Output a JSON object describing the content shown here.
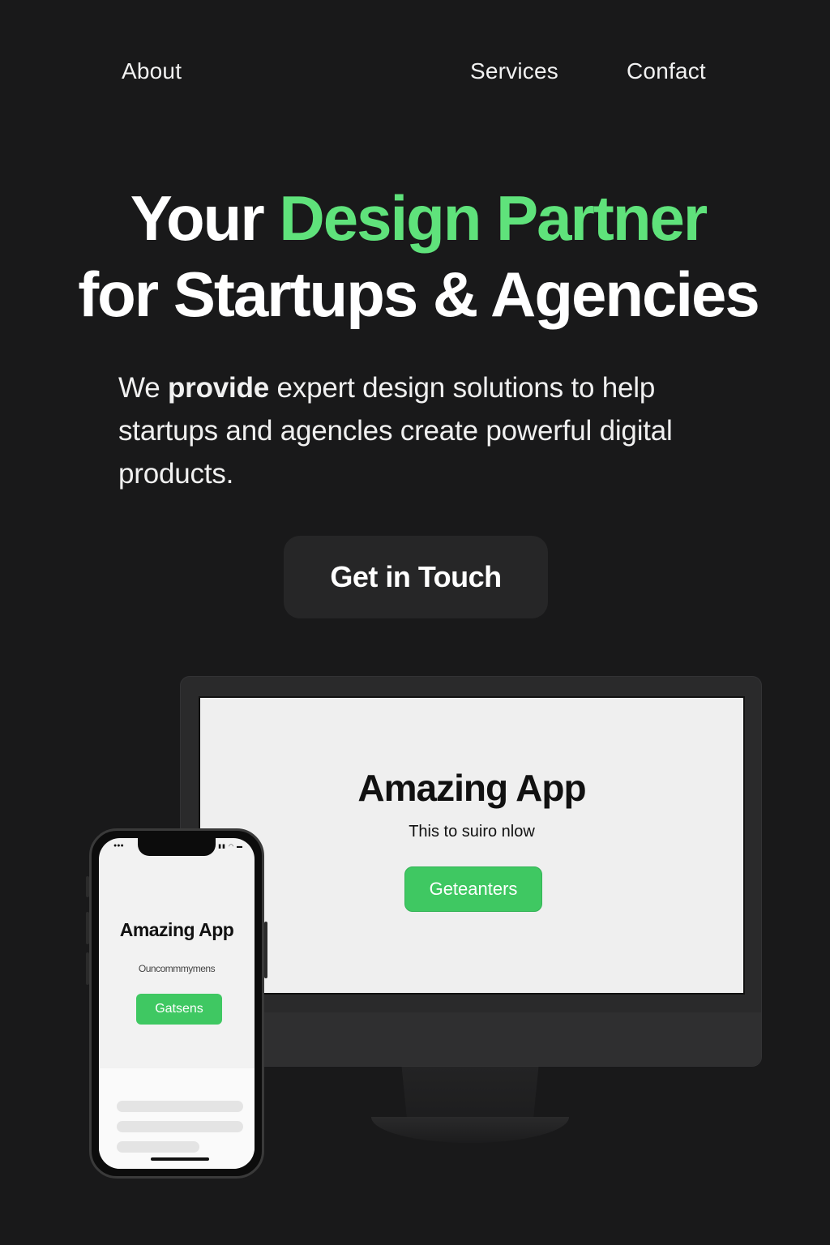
{
  "nav": {
    "about": "About",
    "services": "Services",
    "contact": "Confact"
  },
  "hero": {
    "title_part1": "Your ",
    "title_accent": "Design Partner",
    "title_part2": "for Startups & Agencies",
    "subtitle_part1": "We ",
    "subtitle_bold": "provide",
    "subtitle_part2": " expert design solutions to help startups and agencles create powerful digital products.",
    "cta_label": "Get in Touch"
  },
  "monitor_mockup": {
    "app_title": "Amazing App",
    "app_subtitle": "This to suiro nlow",
    "button_label": "Geteanters"
  },
  "phone_mockup": {
    "app_title": "Amazing App",
    "app_subtitle": "Ouncommmymens",
    "button_label": "Gatsens"
  },
  "colors": {
    "background": "#19191a",
    "accent_green": "#5fe27b",
    "button_green": "#3fc862",
    "cta_background": "#262627"
  }
}
